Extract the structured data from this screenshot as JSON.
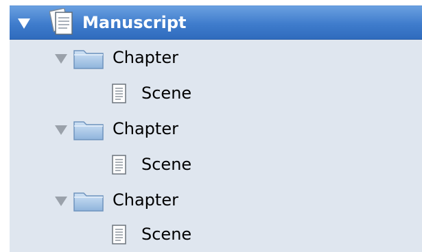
{
  "binder": {
    "root": {
      "label": "Manuscript",
      "icon": "manuscript-stack-icon",
      "expanded": true,
      "selected": true,
      "selection_color": "#3f7ccc"
    },
    "items": [
      {
        "type": "folder",
        "label": "Chapter",
        "icon": "folder-icon",
        "expanded": true,
        "children": [
          {
            "type": "document",
            "label": "Scene",
            "icon": "text-document-icon"
          }
        ]
      },
      {
        "type": "folder",
        "label": "Chapter",
        "icon": "folder-icon",
        "expanded": true,
        "children": [
          {
            "type": "document",
            "label": "Scene",
            "icon": "text-document-icon"
          }
        ]
      },
      {
        "type": "folder",
        "label": "Chapter",
        "icon": "folder-icon",
        "expanded": true,
        "children": [
          {
            "type": "document",
            "label": "Scene",
            "icon": "text-document-icon"
          }
        ]
      }
    ]
  }
}
